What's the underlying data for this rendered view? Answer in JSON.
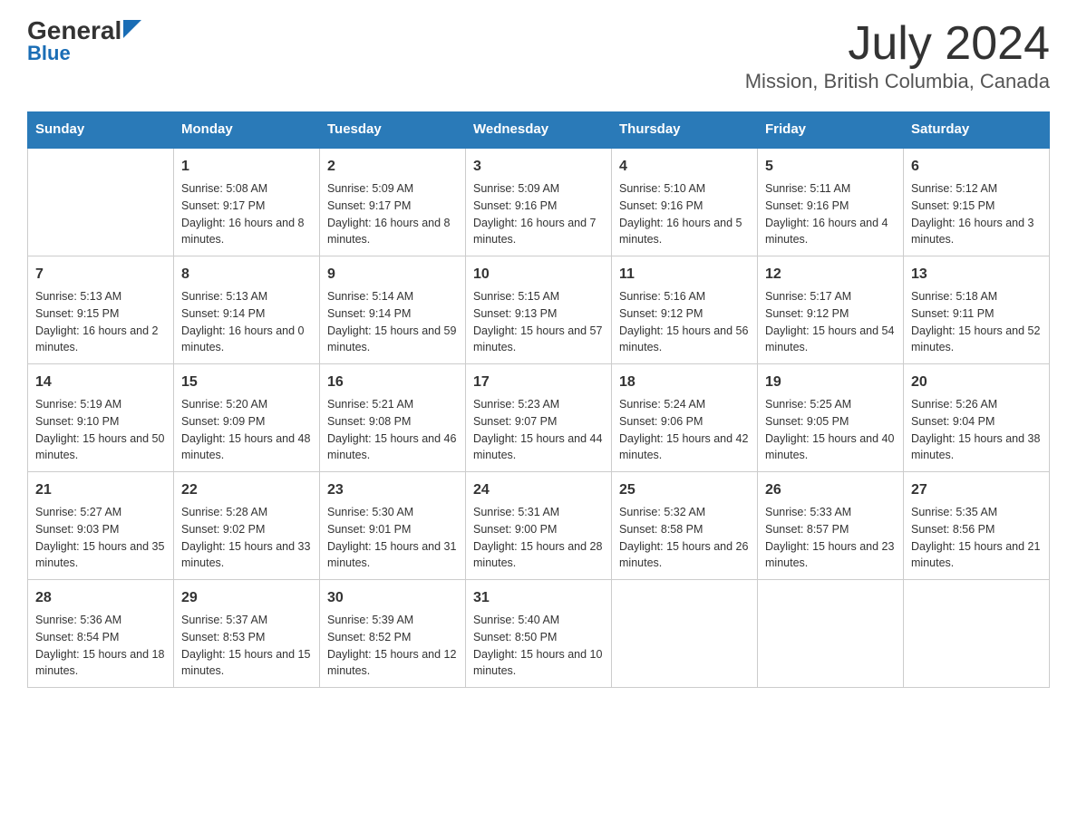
{
  "header": {
    "logo_general": "General",
    "logo_blue": "Blue",
    "title": "July 2024",
    "subtitle": "Mission, British Columbia, Canada"
  },
  "weekdays": [
    "Sunday",
    "Monday",
    "Tuesday",
    "Wednesday",
    "Thursday",
    "Friday",
    "Saturday"
  ],
  "weeks": [
    [
      {
        "day": "",
        "sunrise": "",
        "sunset": "",
        "daylight": ""
      },
      {
        "day": "1",
        "sunrise": "Sunrise: 5:08 AM",
        "sunset": "Sunset: 9:17 PM",
        "daylight": "Daylight: 16 hours and 8 minutes."
      },
      {
        "day": "2",
        "sunrise": "Sunrise: 5:09 AM",
        "sunset": "Sunset: 9:17 PM",
        "daylight": "Daylight: 16 hours and 8 minutes."
      },
      {
        "day": "3",
        "sunrise": "Sunrise: 5:09 AM",
        "sunset": "Sunset: 9:16 PM",
        "daylight": "Daylight: 16 hours and 7 minutes."
      },
      {
        "day": "4",
        "sunrise": "Sunrise: 5:10 AM",
        "sunset": "Sunset: 9:16 PM",
        "daylight": "Daylight: 16 hours and 5 minutes."
      },
      {
        "day": "5",
        "sunrise": "Sunrise: 5:11 AM",
        "sunset": "Sunset: 9:16 PM",
        "daylight": "Daylight: 16 hours and 4 minutes."
      },
      {
        "day": "6",
        "sunrise": "Sunrise: 5:12 AM",
        "sunset": "Sunset: 9:15 PM",
        "daylight": "Daylight: 16 hours and 3 minutes."
      }
    ],
    [
      {
        "day": "7",
        "sunrise": "Sunrise: 5:13 AM",
        "sunset": "Sunset: 9:15 PM",
        "daylight": "Daylight: 16 hours and 2 minutes."
      },
      {
        "day": "8",
        "sunrise": "Sunrise: 5:13 AM",
        "sunset": "Sunset: 9:14 PM",
        "daylight": "Daylight: 16 hours and 0 minutes."
      },
      {
        "day": "9",
        "sunrise": "Sunrise: 5:14 AM",
        "sunset": "Sunset: 9:14 PM",
        "daylight": "Daylight: 15 hours and 59 minutes."
      },
      {
        "day": "10",
        "sunrise": "Sunrise: 5:15 AM",
        "sunset": "Sunset: 9:13 PM",
        "daylight": "Daylight: 15 hours and 57 minutes."
      },
      {
        "day": "11",
        "sunrise": "Sunrise: 5:16 AM",
        "sunset": "Sunset: 9:12 PM",
        "daylight": "Daylight: 15 hours and 56 minutes."
      },
      {
        "day": "12",
        "sunrise": "Sunrise: 5:17 AM",
        "sunset": "Sunset: 9:12 PM",
        "daylight": "Daylight: 15 hours and 54 minutes."
      },
      {
        "day": "13",
        "sunrise": "Sunrise: 5:18 AM",
        "sunset": "Sunset: 9:11 PM",
        "daylight": "Daylight: 15 hours and 52 minutes."
      }
    ],
    [
      {
        "day": "14",
        "sunrise": "Sunrise: 5:19 AM",
        "sunset": "Sunset: 9:10 PM",
        "daylight": "Daylight: 15 hours and 50 minutes."
      },
      {
        "day": "15",
        "sunrise": "Sunrise: 5:20 AM",
        "sunset": "Sunset: 9:09 PM",
        "daylight": "Daylight: 15 hours and 48 minutes."
      },
      {
        "day": "16",
        "sunrise": "Sunrise: 5:21 AM",
        "sunset": "Sunset: 9:08 PM",
        "daylight": "Daylight: 15 hours and 46 minutes."
      },
      {
        "day": "17",
        "sunrise": "Sunrise: 5:23 AM",
        "sunset": "Sunset: 9:07 PM",
        "daylight": "Daylight: 15 hours and 44 minutes."
      },
      {
        "day": "18",
        "sunrise": "Sunrise: 5:24 AM",
        "sunset": "Sunset: 9:06 PM",
        "daylight": "Daylight: 15 hours and 42 minutes."
      },
      {
        "day": "19",
        "sunrise": "Sunrise: 5:25 AM",
        "sunset": "Sunset: 9:05 PM",
        "daylight": "Daylight: 15 hours and 40 minutes."
      },
      {
        "day": "20",
        "sunrise": "Sunrise: 5:26 AM",
        "sunset": "Sunset: 9:04 PM",
        "daylight": "Daylight: 15 hours and 38 minutes."
      }
    ],
    [
      {
        "day": "21",
        "sunrise": "Sunrise: 5:27 AM",
        "sunset": "Sunset: 9:03 PM",
        "daylight": "Daylight: 15 hours and 35 minutes."
      },
      {
        "day": "22",
        "sunrise": "Sunrise: 5:28 AM",
        "sunset": "Sunset: 9:02 PM",
        "daylight": "Daylight: 15 hours and 33 minutes."
      },
      {
        "day": "23",
        "sunrise": "Sunrise: 5:30 AM",
        "sunset": "Sunset: 9:01 PM",
        "daylight": "Daylight: 15 hours and 31 minutes."
      },
      {
        "day": "24",
        "sunrise": "Sunrise: 5:31 AM",
        "sunset": "Sunset: 9:00 PM",
        "daylight": "Daylight: 15 hours and 28 minutes."
      },
      {
        "day": "25",
        "sunrise": "Sunrise: 5:32 AM",
        "sunset": "Sunset: 8:58 PM",
        "daylight": "Daylight: 15 hours and 26 minutes."
      },
      {
        "day": "26",
        "sunrise": "Sunrise: 5:33 AM",
        "sunset": "Sunset: 8:57 PM",
        "daylight": "Daylight: 15 hours and 23 minutes."
      },
      {
        "day": "27",
        "sunrise": "Sunrise: 5:35 AM",
        "sunset": "Sunset: 8:56 PM",
        "daylight": "Daylight: 15 hours and 21 minutes."
      }
    ],
    [
      {
        "day": "28",
        "sunrise": "Sunrise: 5:36 AM",
        "sunset": "Sunset: 8:54 PM",
        "daylight": "Daylight: 15 hours and 18 minutes."
      },
      {
        "day": "29",
        "sunrise": "Sunrise: 5:37 AM",
        "sunset": "Sunset: 8:53 PM",
        "daylight": "Daylight: 15 hours and 15 minutes."
      },
      {
        "day": "30",
        "sunrise": "Sunrise: 5:39 AM",
        "sunset": "Sunset: 8:52 PM",
        "daylight": "Daylight: 15 hours and 12 minutes."
      },
      {
        "day": "31",
        "sunrise": "Sunrise: 5:40 AM",
        "sunset": "Sunset: 8:50 PM",
        "daylight": "Daylight: 15 hours and 10 minutes."
      },
      {
        "day": "",
        "sunrise": "",
        "sunset": "",
        "daylight": ""
      },
      {
        "day": "",
        "sunrise": "",
        "sunset": "",
        "daylight": ""
      },
      {
        "day": "",
        "sunrise": "",
        "sunset": "",
        "daylight": ""
      }
    ]
  ]
}
